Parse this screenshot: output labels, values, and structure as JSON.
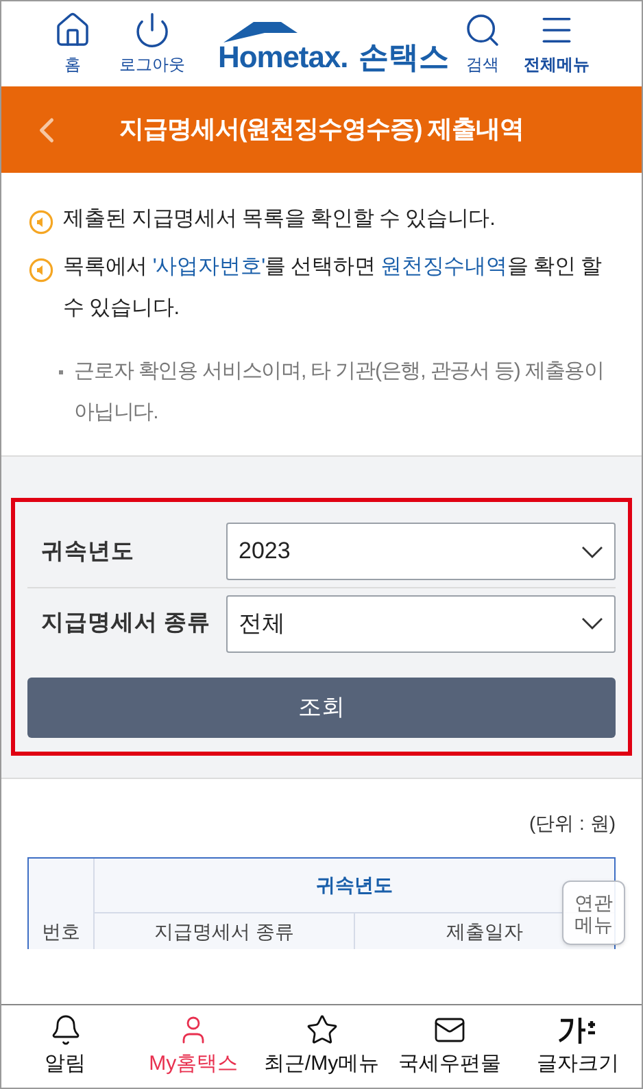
{
  "header": {
    "left": [
      {
        "kind": "home",
        "label": "홈"
      },
      {
        "kind": "logout",
        "label": "로그아웃"
      }
    ],
    "logo": {
      "brand": "Hometax.",
      "app": "손택스"
    },
    "right": [
      {
        "kind": "search",
        "label": "검색"
      },
      {
        "kind": "menu",
        "label": "전체메뉴"
      }
    ]
  },
  "title_bar": {
    "title": "지급명세서(원천징수영수증) 제출내역"
  },
  "notices": [
    {
      "segments": [
        {
          "text": "제출된 지급명세서 목록을 확인할 수 있습니다.",
          "link": false
        }
      ]
    },
    {
      "segments": [
        {
          "text": "목록에서 ",
          "link": false
        },
        {
          "text": "'사업자번호'",
          "link": true
        },
        {
          "text": "를 선택하면 ",
          "link": false
        },
        {
          "text": "원천징수내역",
          "link": true
        },
        {
          "text": "을 확인 할 수 있습니다.",
          "link": false
        }
      ]
    }
  ],
  "note": "근로자 확인용 서비스이며, 타 기관(은행, 관공서 등) 제출용이 아닙니다.",
  "filters": [
    {
      "label": "귀속년도",
      "value": "2023"
    },
    {
      "label": "지급명세서 종류",
      "value": "전체"
    }
  ],
  "search_button": "조회",
  "unit": "(단위 : 원)",
  "table": {
    "group_header": "귀속년도",
    "number_header": "번호",
    "columns": [
      "지급명세서 종류",
      "제출일자"
    ]
  },
  "related_menu": "연관메뉴",
  "bottom_nav": [
    {
      "kind": "bell",
      "label": "알림",
      "selected": false
    },
    {
      "kind": "user",
      "label": "My홈택스",
      "selected": true
    },
    {
      "kind": "star",
      "label": "최근/My메뉴",
      "selected": false
    },
    {
      "kind": "mail",
      "label": "국세우편물",
      "selected": false
    },
    {
      "kind": "font",
      "label": "글자크기",
      "selected": false
    }
  ]
}
